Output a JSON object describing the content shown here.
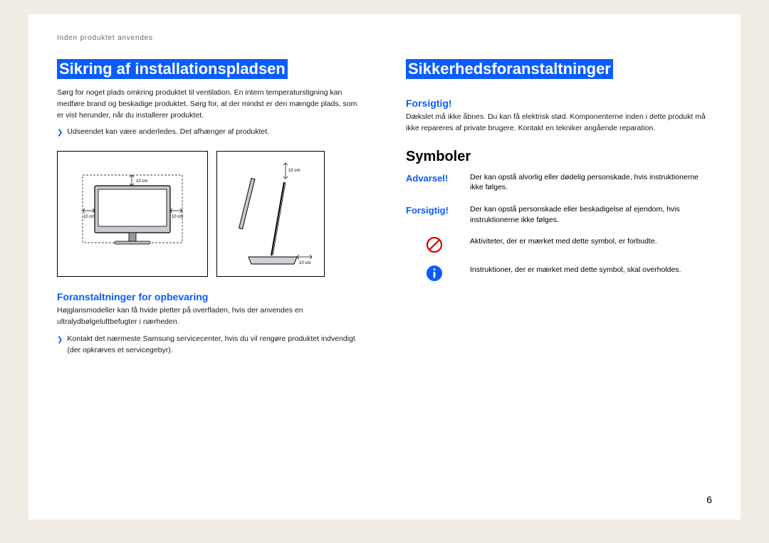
{
  "header": "Inden produktet anvendes",
  "left": {
    "title": "Sikring af installationspladsen",
    "intro": "Sørg for noget plads omkring produktet til ventilation. En intern temperaturstigning kan medføre brand og beskadige produktet. Sørg for, at der mindst er den mængde plads, som er vist herunder, når du installerer produktet.",
    "bullet1": "Udseendet kan være anderledes. Det afhænger af produktet.",
    "dim_label": "10 cm",
    "sub_title": "Foranstaltninger for opbevaring",
    "sub_body": "Højglansmodeller kan få hvide pletter på overfladen, hvis der anvendes en ultralydbølgeluftbefugter i nærheden.",
    "bullet2": "Kontakt det nærmeste Samsung servicecenter, hvis du vil rengøre produktet indvendigt (der opkræves et servicegebyr)."
  },
  "right": {
    "title": "Sikkerhedsforanstaltninger",
    "caution_label": "Forsigtig!",
    "caution_body": "Dækslet må ikke åbnes. Du kan få elektrisk stød. Komponenterne inden i dette produkt må ikke repareres af private brugere. Kontakt en tekniker angående reparation.",
    "symbols_title": "Symboler",
    "warn_label": "Advarsel!",
    "warn_desc": "Der kan opstå alvorlig eller dødelig personskade, hvis instruktionerne ikke følges.",
    "caution2_label": "Forsigtig!",
    "caution2_desc": "Der kan opstå personskade eller beskadigelse af ejendom, hvis instruktionerne ikke følges.",
    "prohibit_desc": "Aktiviteter, der er mærket med dette symbol, er forbudte.",
    "info_desc": "Instruktioner, der er mærket med dette symbol, skal overholdes."
  },
  "page_number": "6"
}
